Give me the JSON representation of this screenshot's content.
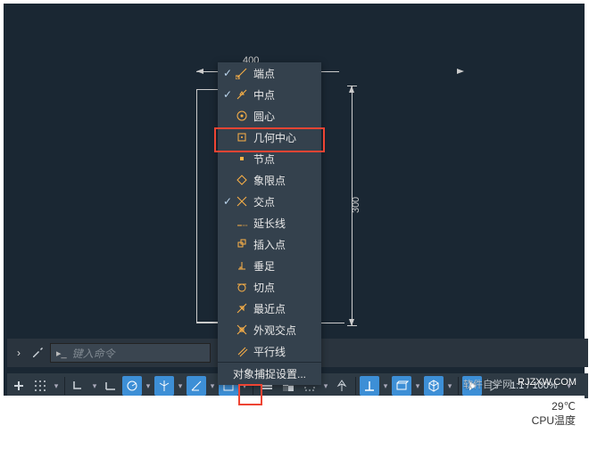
{
  "dimension": {
    "top_value": "400",
    "right_value": "300"
  },
  "snap_menu": {
    "items": [
      {
        "label": "端点",
        "checked": true
      },
      {
        "label": "中点",
        "checked": true
      },
      {
        "label": "圆心",
        "checked": false
      },
      {
        "label": "几何中心",
        "checked": false
      },
      {
        "label": "节点",
        "checked": false
      },
      {
        "label": "象限点",
        "checked": false
      },
      {
        "label": "交点",
        "checked": true
      },
      {
        "label": "延长线",
        "checked": false
      },
      {
        "label": "插入点",
        "checked": false
      },
      {
        "label": "垂足",
        "checked": false
      },
      {
        "label": "切点",
        "checked": false
      },
      {
        "label": "最近点",
        "checked": false
      },
      {
        "label": "外观交点",
        "checked": false
      },
      {
        "label": "平行线",
        "checked": false
      }
    ],
    "settings_label": "对象捕捉设置..."
  },
  "command": {
    "placeholder": "键入命令"
  },
  "status": {
    "zoom": "1:1 / 100%"
  },
  "watermark": {
    "site_cn": "软件自学网",
    "site_en": "RJZXW.COM"
  },
  "temp": {
    "line1": "29℃",
    "line2": "CPU温度"
  }
}
